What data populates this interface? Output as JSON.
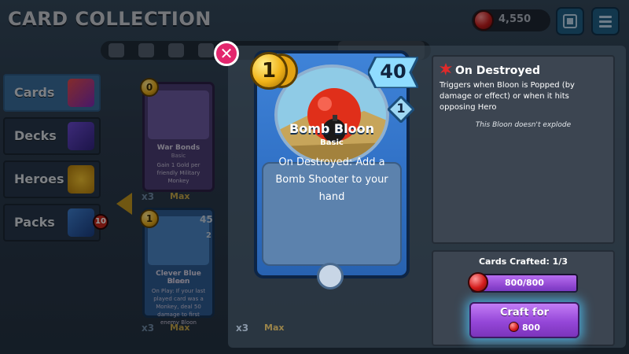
{
  "header": {
    "title": "CARD COLLECTION",
    "currency_amount": "4,550"
  },
  "sidebar": {
    "items": [
      {
        "label": "Cards",
        "active": true
      },
      {
        "label": "Decks",
        "active": false
      },
      {
        "label": "Heroes",
        "active": false
      },
      {
        "label": "Packs",
        "active": false,
        "badge": "10"
      }
    ]
  },
  "background_cards": [
    {
      "cost": "0",
      "name": "War Bonds",
      "subtype": "Basic",
      "desc": "Gain 1 Gold per friendly Military Monkey",
      "count": "x3",
      "max": "Max"
    },
    {
      "cost": "1",
      "name": "Clever Blue Bloon",
      "subtype": "Basic",
      "hp": "45",
      "armor": "2",
      "desc": "On Play: If your last played card was a Monkey, deal 50 damage to first enemy Bloon",
      "count": "x3",
      "max": "Max"
    }
  ],
  "main_card": {
    "name": "Bomb Bloon",
    "type": "Basic",
    "cost": "1",
    "health": "40",
    "armor": "1",
    "description": "On Destroyed: Add a Bomb Shooter to your hand"
  },
  "detail": {
    "ability_title": "On Destroyed",
    "ability_desc": "Triggers when Bloon is Popped (by damage or effect) or when it hits opposing Hero",
    "note": "This Bloon doesn't explode"
  },
  "craft": {
    "crafted_label": "Cards Crafted: 1/3",
    "progress_text": "800/800",
    "progress_fraction": 1.0,
    "button_label": "Craft for",
    "button_cost": "800"
  },
  "background_misc": {
    "partial_count": "x3",
    "partial_max": "Max"
  },
  "colors": {
    "accent_purple": "#9547d8",
    "card_blue": "#2f6fc4",
    "close_pink": "#e3266d"
  }
}
